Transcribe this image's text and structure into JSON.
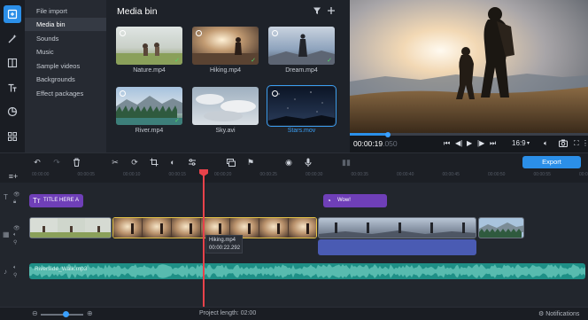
{
  "rail": {
    "icons": [
      "media-import-icon",
      "magic-wand-icon",
      "transitions-icon",
      "titles-icon",
      "stickers-icon",
      "more-tools-icon"
    ]
  },
  "categories": [
    "File import",
    "Media bin",
    "Sounds",
    "Music",
    "Sample videos",
    "Backgrounds",
    "Effect packages"
  ],
  "media_bin": {
    "title": "Media bin",
    "items": [
      {
        "name": "Nature.mp4",
        "checked": true
      },
      {
        "name": "Hiking.mp4",
        "checked": true
      },
      {
        "name": "Dream.mp4",
        "checked": true
      },
      {
        "name": "River.mp4",
        "checked": true
      },
      {
        "name": "Sky.avi",
        "checked": false
      },
      {
        "name": "Stars.mov",
        "checked": false,
        "selected": true
      }
    ]
  },
  "preview": {
    "time": "00:00:19",
    "time_frac": ".050",
    "progress": 0.16,
    "aspect": "16:9"
  },
  "toolbar": {
    "export_label": "Export"
  },
  "ruler": {
    "ticks": [
      "00:00:00",
      "00:00:05",
      "00:00:10",
      "00:00:15",
      "00:00:20",
      "00:00:25",
      "00:00:30",
      "00:00:35",
      "00:00:40",
      "00:00:45",
      "00:00:50",
      "00:00:55",
      "00:01:00"
    ]
  },
  "timeline": {
    "title_clips": [
      "TITLE HERE A",
      "Wow!"
    ],
    "tooltip": {
      "name": "Hiking.mp4",
      "time": "00:00:22.292"
    },
    "audio_clip": "Riverside_Walk.mp3"
  },
  "status": {
    "project_length": "Project length:  02:00",
    "zoom": 0.6,
    "notifications": "Notifications"
  },
  "colors": {
    "accent": "#2b8fe8",
    "title_clip": "#6f3fb8",
    "audio": "#1e8f86",
    "playhead": "#e8424a",
    "selection": "#e8c547"
  }
}
